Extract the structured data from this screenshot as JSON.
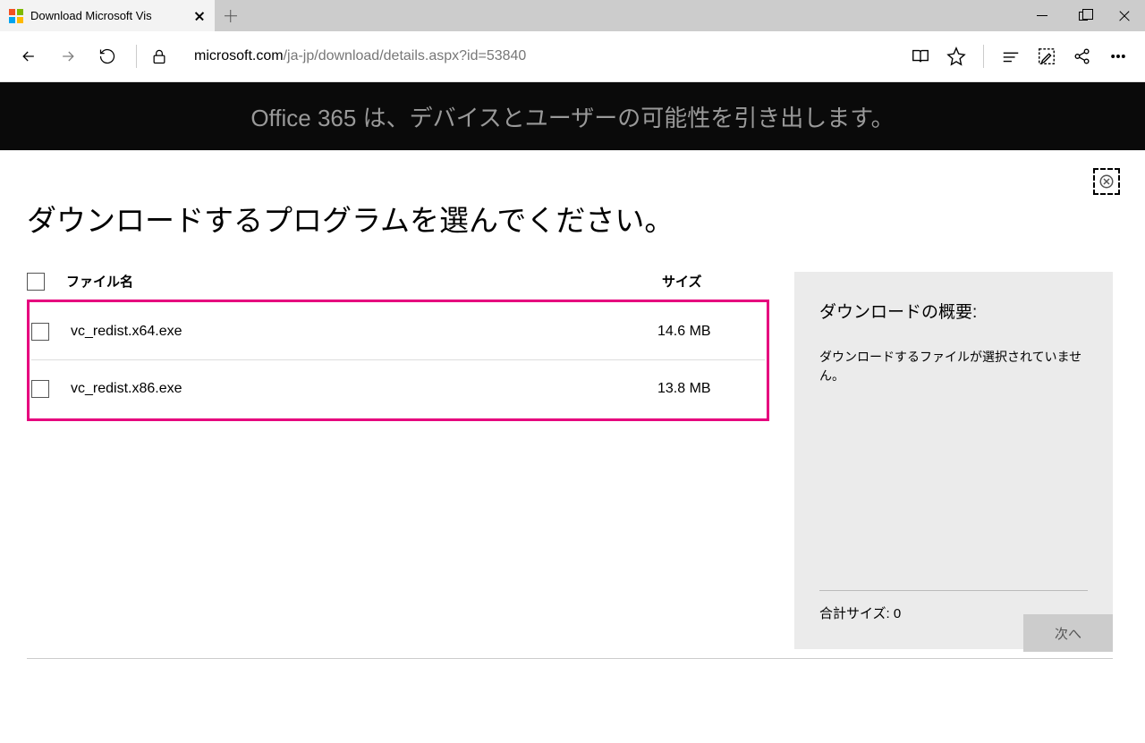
{
  "tab": {
    "title": "Download Microsoft Vis"
  },
  "address": {
    "host": "microsoft.com",
    "path": "/ja-jp/download/details.aspx?id=53840"
  },
  "banner": "Office 365 は、デバイスとユーザーの可能性を引き出します。",
  "page_title": "ダウンロードするプログラムを選んでください。",
  "table": {
    "header": {
      "filename": "ファイル名",
      "size": "サイズ"
    },
    "rows": [
      {
        "name": "vc_redist.x64.exe",
        "size": "14.6 MB"
      },
      {
        "name": "vc_redist.x86.exe",
        "size": "13.8 MB"
      }
    ]
  },
  "summary": {
    "title": "ダウンロードの概要:",
    "none": "ダウンロードするファイルが選択されていません。",
    "total_label": "合計サイズ: 0"
  },
  "next": "次へ"
}
